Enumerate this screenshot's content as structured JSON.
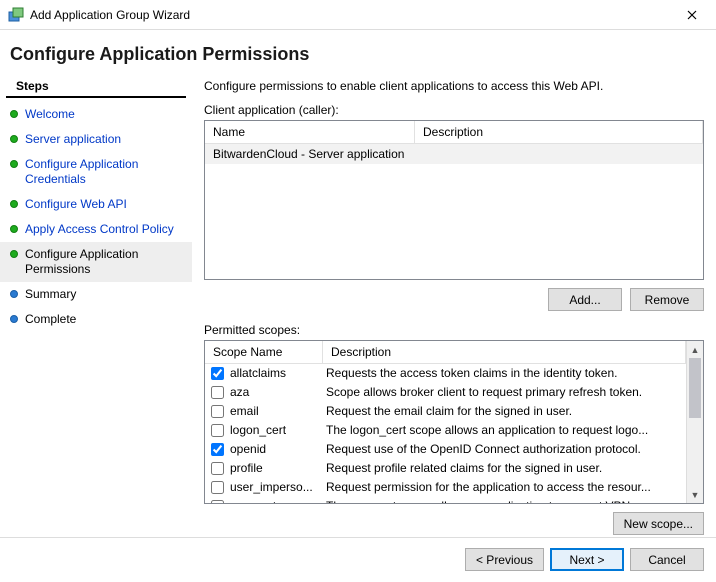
{
  "window": {
    "title": "Add Application Group Wizard"
  },
  "header": {
    "title": "Configure Application Permissions"
  },
  "sidebar": {
    "heading": "Steps",
    "items": [
      {
        "label": "Welcome",
        "state": "done"
      },
      {
        "label": "Server application",
        "state": "done"
      },
      {
        "label": "Configure Application Credentials",
        "state": "done"
      },
      {
        "label": "Configure Web API",
        "state": "done"
      },
      {
        "label": "Apply Access Control Policy",
        "state": "done"
      },
      {
        "label": "Configure Application Permissions",
        "state": "current"
      },
      {
        "label": "Summary",
        "state": "todo"
      },
      {
        "label": "Complete",
        "state": "todo"
      }
    ]
  },
  "main": {
    "instruction": "Configure permissions to enable client applications to access this Web API.",
    "client_label": "Client application (caller):",
    "client_cols": {
      "name": "Name",
      "desc": "Description"
    },
    "client_rows": [
      {
        "name": "BitwardenCloud - Server application",
        "desc": ""
      }
    ],
    "buttons": {
      "add": "Add...",
      "remove": "Remove",
      "new_scope": "New scope..."
    },
    "scopes_label": "Permitted scopes:",
    "scope_cols": {
      "name": "Scope Name",
      "desc": "Description"
    },
    "scopes": [
      {
        "name": "allatclaims",
        "desc": "Requests the access token claims in the identity token.",
        "checked": true
      },
      {
        "name": "aza",
        "desc": "Scope allows broker client to request primary refresh token.",
        "checked": false
      },
      {
        "name": "email",
        "desc": "Request the email claim for the signed in user.",
        "checked": false
      },
      {
        "name": "logon_cert",
        "desc": "The logon_cert scope allows an application to request logo...",
        "checked": false
      },
      {
        "name": "openid",
        "desc": "Request use of the OpenID Connect authorization protocol.",
        "checked": true
      },
      {
        "name": "profile",
        "desc": "Request profile related claims for the signed in user.",
        "checked": false
      },
      {
        "name": "user_imperso...",
        "desc": "Request permission for the application to access the resour...",
        "checked": false
      },
      {
        "name": "vpn_cert",
        "desc": "The vpn_cert scope allows an application to request VPN ...",
        "checked": false
      }
    ]
  },
  "footer": {
    "previous": "< Previous",
    "next": "Next >",
    "cancel": "Cancel"
  }
}
